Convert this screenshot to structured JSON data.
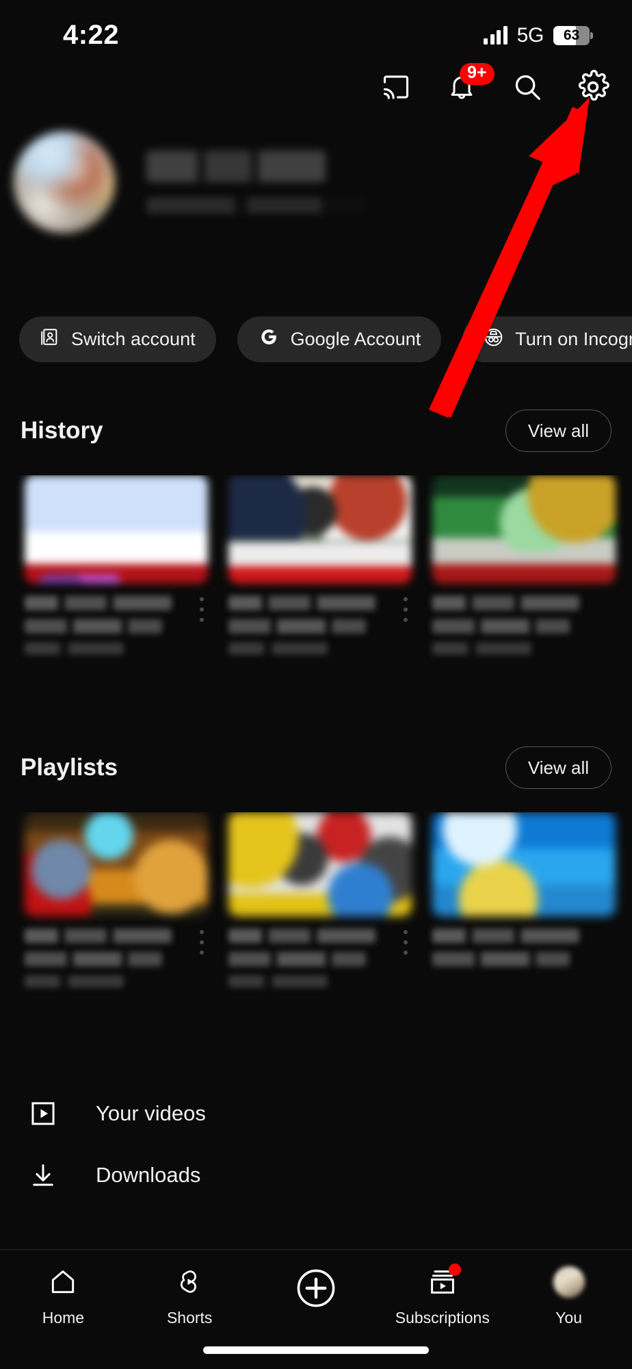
{
  "status_bar": {
    "time": "4:22",
    "network": "5G",
    "battery_percent": "63",
    "signal_icon": "signal-bars-icon"
  },
  "top_actions": [
    {
      "name": "cast-icon",
      "label": "Cast"
    },
    {
      "name": "notifications-bell-icon",
      "label": "Notifications",
      "badge": "9+"
    },
    {
      "name": "search-icon",
      "label": "Search"
    },
    {
      "name": "settings-gear-icon",
      "label": "Settings"
    }
  ],
  "profile": {
    "name": "",
    "handle": "",
    "avatar": "user-avatar",
    "redacted": true
  },
  "chips": [
    {
      "label": "Switch account",
      "icon": "switch-account-icon"
    },
    {
      "label": "Google Account",
      "icon": "google-g-icon"
    },
    {
      "label": "Turn on Incognito",
      "icon": "incognito-icon"
    }
  ],
  "sections": [
    {
      "title": "History",
      "view_all_label": "View all",
      "cards": [
        {
          "thumb_class": "t1",
          "redacted": true
        },
        {
          "thumb_class": "t2",
          "redacted": true
        },
        {
          "thumb_class": "t3",
          "redacted": true
        }
      ]
    },
    {
      "title": "Playlists",
      "view_all_label": "View all",
      "cards": [
        {
          "thumb_class": "p1",
          "redacted": true
        },
        {
          "thumb_class": "p2",
          "redacted": true
        },
        {
          "thumb_class": "p3",
          "redacted": true
        }
      ]
    }
  ],
  "menu_items": [
    {
      "label": "Your videos",
      "icon": "play-square-icon"
    },
    {
      "label": "Downloads",
      "icon": "download-arrow-icon"
    }
  ],
  "bottom_nav": [
    {
      "label": "Home",
      "icon": "home-icon",
      "badge": false
    },
    {
      "label": "Shorts",
      "icon": "shorts-icon",
      "badge": false
    },
    {
      "label": "",
      "icon": "create-plus-icon",
      "badge": false
    },
    {
      "label": "Subscriptions",
      "icon": "subscriptions-icon",
      "badge": true
    },
    {
      "label": "You",
      "icon": "you-avatar-icon",
      "badge": false
    }
  ],
  "annotation": {
    "type": "arrow",
    "color": "#FF0000",
    "points_to": "settings-gear-icon"
  },
  "colors": {
    "background": "#0a0a0a",
    "chip_background": "#282828",
    "accent_red": "#FF0000",
    "text_primary": "#f1f1f1",
    "border": "#565656"
  }
}
